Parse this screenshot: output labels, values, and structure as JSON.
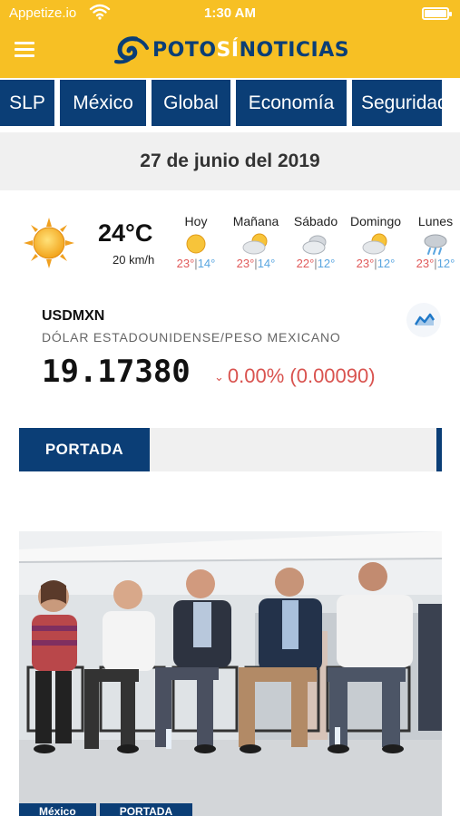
{
  "status_bar": {
    "carrier": "Appetize.io",
    "time": "1:30 AM",
    "icons": [
      "wifi-icon",
      "battery-icon"
    ]
  },
  "header": {
    "logo_text_primary": "POTO",
    "logo_text_accent": "SÍ",
    "logo_text_secondary": "NOTICIAS",
    "menu_icon": "hamburger-menu-icon",
    "colors": {
      "background": "#f7c024",
      "brand_blue": "#0b3e76"
    }
  },
  "categories": [
    {
      "label": "SLP"
    },
    {
      "label": "México"
    },
    {
      "label": "Global"
    },
    {
      "label": "Economía"
    },
    {
      "label": "Seguridad"
    }
  ],
  "date": "27 de junio del 2019",
  "weather": {
    "current_temp": "24°C",
    "wind": "20 km/h",
    "current_icon": "sun-icon",
    "forecast": [
      {
        "day": "Hoy",
        "icon": "sun-icon",
        "high": "23°",
        "low": "14°"
      },
      {
        "day": "Mañana",
        "icon": "partly-cloudy-icon",
        "high": "23°",
        "low": "14°"
      },
      {
        "day": "Sábado",
        "icon": "cloudy-icon",
        "high": "22°",
        "low": "12°"
      },
      {
        "day": "Domingo",
        "icon": "partly-cloudy-icon",
        "high": "23°",
        "low": "12°"
      },
      {
        "day": "Lunes",
        "icon": "rain-icon",
        "high": "23°",
        "low": "12°"
      }
    ],
    "separator": "|",
    "colors": {
      "high": "#e05a5a",
      "low": "#5aa6e0"
    }
  },
  "currency": {
    "code": "USDMXN",
    "name": "DÓLAR ESTADOUNIDENSE/PESO MEXICANO",
    "value": "19.17380",
    "change_arrow": "⌄",
    "change": "0.00% (0.00090)",
    "chart_icon": "chart-icon",
    "colors": {
      "change": "#d9534f"
    }
  },
  "section": {
    "label": "PORTADA"
  },
  "article": {
    "image": "group-of-people-seated-on-stage-photo",
    "tags": [
      "México",
      "PORTADA"
    ]
  }
}
